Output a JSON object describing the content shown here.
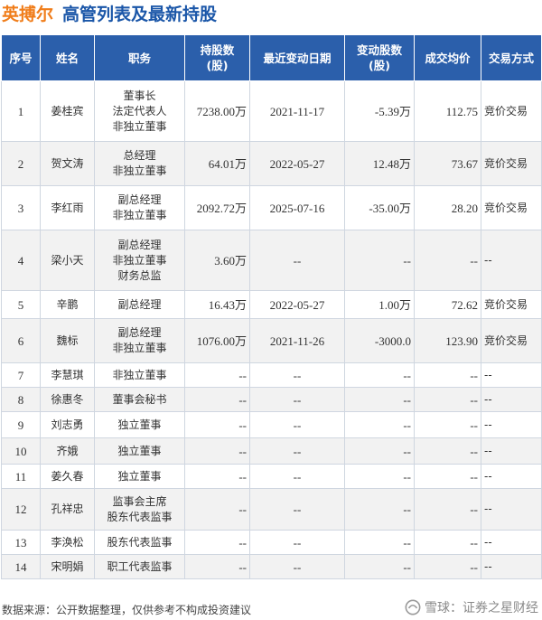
{
  "title": {
    "company": "英搏尔",
    "subject": "高管列表及最新持股"
  },
  "table": {
    "headers": [
      "序号",
      "姓名",
      "职务",
      "持股数\n(股)",
      "最近变动日期",
      "变动股数\n(股)",
      "成交均价",
      "交易方式"
    ],
    "rows": [
      {
        "no": "1",
        "name": "姜桂宾",
        "roles": [
          "董事长",
          "法定代表人",
          "非独立董事"
        ],
        "shares": "7238.00万",
        "date": "2021-11-17",
        "change": "-5.39万",
        "change_dir": "neg",
        "price": "112.75",
        "price_dir": "neg",
        "method": "竞价交易"
      },
      {
        "no": "2",
        "name": "贺文涛",
        "roles": [
          "总经理",
          "非独立董事"
        ],
        "shares": "64.01万",
        "date": "2022-05-27",
        "change": "12.48万",
        "change_dir": "pos",
        "price": "73.67",
        "price_dir": "pos",
        "method": "竞价交易"
      },
      {
        "no": "3",
        "name": "李红雨",
        "roles": [
          "副总经理",
          "非独立董事"
        ],
        "shares": "2092.72万",
        "date": "2025-07-16",
        "change": "-35.00万",
        "change_dir": "neg",
        "price": "28.20",
        "price_dir": "neg",
        "method": "竞价交易"
      },
      {
        "no": "4",
        "name": "梁小天",
        "roles": [
          "副总经理",
          "非独立董事",
          "财务总监"
        ],
        "shares": "3.60万",
        "date": "--",
        "change": "--",
        "change_dir": "",
        "price": "--",
        "price_dir": "",
        "method": "--"
      },
      {
        "no": "5",
        "name": "辛鹏",
        "roles": [
          "副总经理"
        ],
        "shares": "16.43万",
        "date": "2022-05-27",
        "change": "1.00万",
        "change_dir": "pos",
        "price": "72.62",
        "price_dir": "pos",
        "method": "竞价交易"
      },
      {
        "no": "6",
        "name": "魏标",
        "roles": [
          "副总经理",
          "非独立董事"
        ],
        "shares": "1076.00万",
        "date": "2021-11-26",
        "change": "-3000.0",
        "change_dir": "neg",
        "price": "123.90",
        "price_dir": "neg",
        "method": "竞价交易"
      },
      {
        "no": "7",
        "name": "李慧琪",
        "roles": [
          "非独立董事"
        ],
        "shares": "--",
        "date": "--",
        "change": "--",
        "change_dir": "",
        "price": "--",
        "price_dir": "",
        "method": "--"
      },
      {
        "no": "8",
        "name": "徐惠冬",
        "roles": [
          "董事会秘书"
        ],
        "shares": "--",
        "date": "--",
        "change": "--",
        "change_dir": "",
        "price": "--",
        "price_dir": "",
        "method": "--"
      },
      {
        "no": "9",
        "name": "刘志勇",
        "roles": [
          "独立董事"
        ],
        "shares": "--",
        "date": "--",
        "change": "--",
        "change_dir": "",
        "price": "--",
        "price_dir": "",
        "method": "--"
      },
      {
        "no": "10",
        "name": "齐娥",
        "roles": [
          "独立董事"
        ],
        "shares": "--",
        "date": "--",
        "change": "--",
        "change_dir": "",
        "price": "--",
        "price_dir": "",
        "method": "--"
      },
      {
        "no": "11",
        "name": "姜久春",
        "roles": [
          "独立董事"
        ],
        "shares": "--",
        "date": "--",
        "change": "--",
        "change_dir": "",
        "price": "--",
        "price_dir": "",
        "method": "--"
      },
      {
        "no": "12",
        "name": "孔祥忠",
        "roles": [
          "监事会主席",
          "股东代表监事"
        ],
        "shares": "--",
        "date": "--",
        "change": "--",
        "change_dir": "",
        "price": "--",
        "price_dir": "",
        "method": "--"
      },
      {
        "no": "13",
        "name": "李涣松",
        "roles": [
          "股东代表监事"
        ],
        "shares": "--",
        "date": "--",
        "change": "--",
        "change_dir": "",
        "price": "--",
        "price_dir": "",
        "method": "--"
      },
      {
        "no": "14",
        "name": "宋明娟",
        "roles": [
          "职工代表监事"
        ],
        "shares": "--",
        "date": "--",
        "change": "--",
        "change_dir": "",
        "price": "--",
        "price_dir": "",
        "method": "--"
      }
    ]
  },
  "footer": {
    "source": "数据来源：公开数据整理，仅供参考不构成投资建议",
    "brand": "雪球：证券之星财经"
  },
  "colors": {
    "header_bg": "#2b5fab",
    "company": "#f07d1a",
    "subject": "#1a56a8",
    "positive": "#d9232d",
    "negative": "#1e9e3a"
  },
  "icons": {
    "brand_logo": "snowball-logo-icon"
  }
}
